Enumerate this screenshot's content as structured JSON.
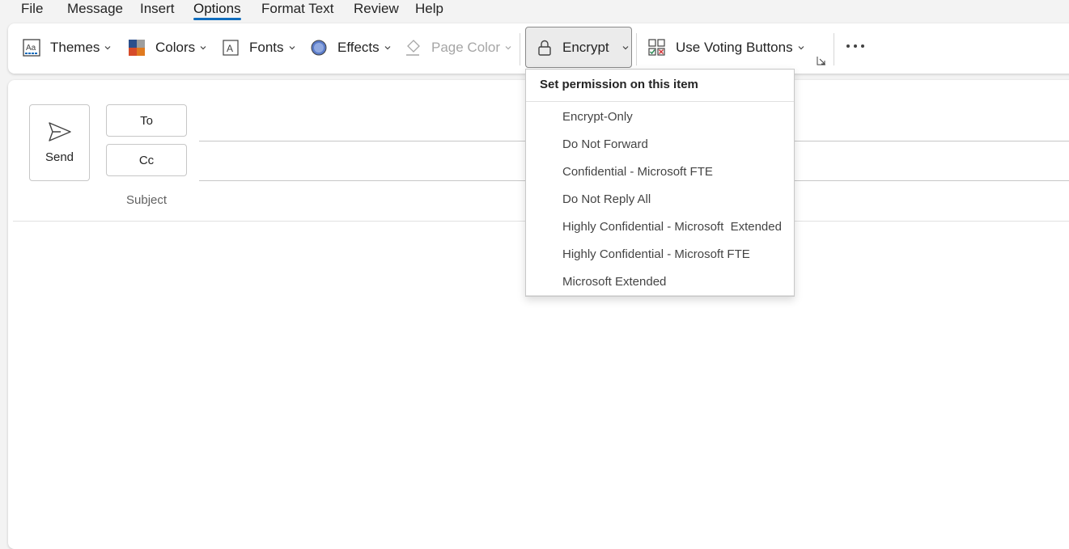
{
  "menu": {
    "tabs": [
      {
        "label": "File"
      },
      {
        "label": "Message"
      },
      {
        "label": "Insert"
      },
      {
        "label": "Options"
      },
      {
        "label": "Format Text"
      },
      {
        "label": "Review"
      },
      {
        "label": "Help"
      }
    ],
    "active": "Options"
  },
  "ribbon": {
    "themes": "Themes",
    "colors": "Colors",
    "fonts": "Fonts",
    "effects": "Effects",
    "page_color": "Page Color",
    "encrypt": "Encrypt",
    "voting": "Use Voting Buttons"
  },
  "compose": {
    "send": "Send",
    "to": "To",
    "cc": "Cc",
    "subject": "Subject"
  },
  "encrypt_menu": {
    "header": "Set permission on this item",
    "items": [
      "Encrypt-Only",
      "Do Not Forward",
      "Confidential - Microsoft FTE",
      "Do Not Reply All",
      "Highly Confidential - Microsoft  Extended",
      "Highly Confidential - Microsoft FTE",
      "Microsoft Extended"
    ]
  },
  "colors": {
    "accent": "#0f6cbd",
    "background": "#f3f3f3",
    "surface": "#ffffff"
  }
}
